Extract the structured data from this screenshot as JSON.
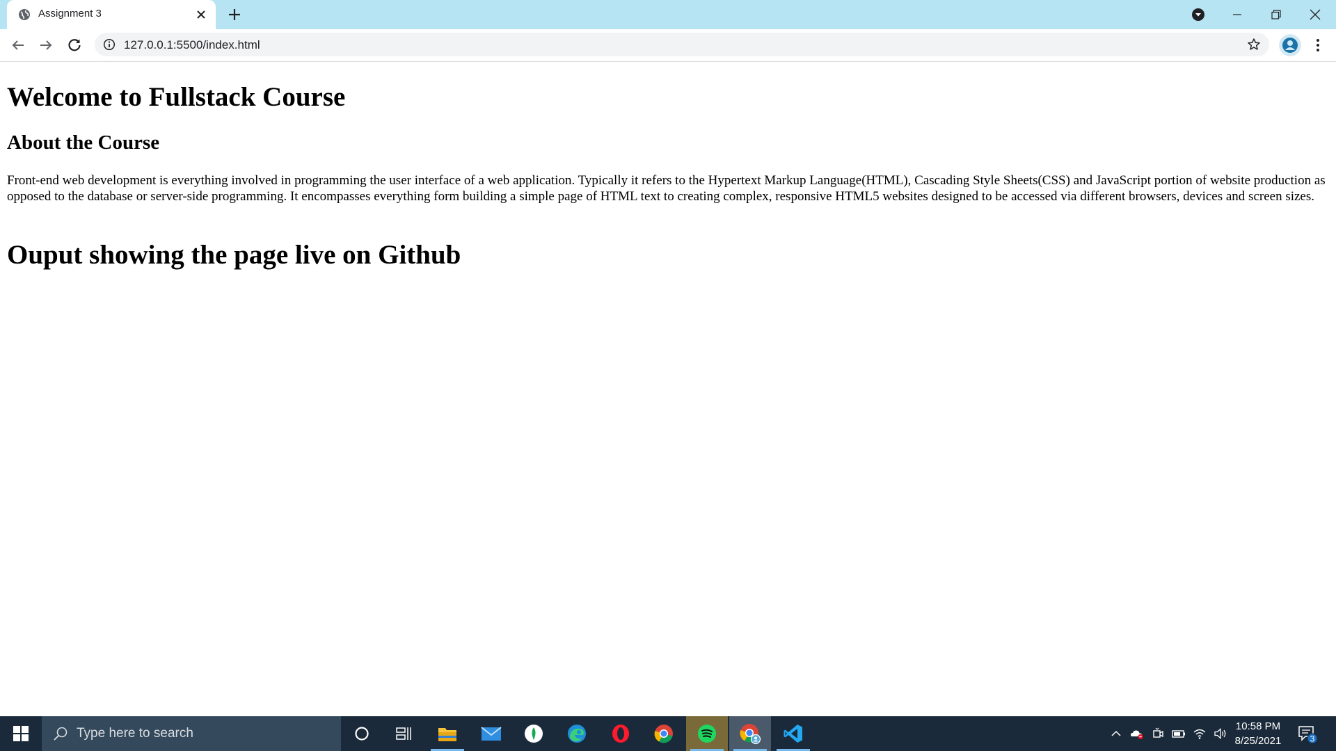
{
  "browser": {
    "tab": {
      "title": "Assignment 3"
    },
    "address_bar": {
      "url": "127.0.0.1:5500/index.html"
    }
  },
  "page": {
    "heading1": "Welcome to Fullstack Course",
    "heading2": "About the Course",
    "paragraph": "Front-end web development is everything involved in programming the user interface of a web application. Typically it refers to the Hypertext Markup Language(HTML), Cascading Style Sheets(CSS) and JavaScript portion of website production as opposed to the database or server-side programming. It encompasses everything form building a simple page of HTML text to creating complex, responsive HTML5 websites designed to be accessed via different browsers, devices and screen sizes.",
    "heading3": "Ouput showing the page live on Github"
  },
  "taskbar": {
    "search_placeholder": "Type here to search",
    "pinned_icons": [
      "cortana-icon",
      "task-view-icon",
      "file-explorer-icon",
      "mail-icon",
      "mongodb-compass-icon",
      "edge-icon",
      "opera-icon",
      "chrome-icon",
      "spotify-icon",
      "chrome-profile-icon",
      "vscode-icon"
    ],
    "clock": {
      "time": "10:58 PM",
      "date": "8/25/2021"
    },
    "notification_count": "3"
  },
  "colors": {
    "tabbar_bg": "#b7e4f2",
    "taskbar_bg": "#1b2a3a",
    "search_bg": "#34495c",
    "accent": "#76b9ed"
  }
}
